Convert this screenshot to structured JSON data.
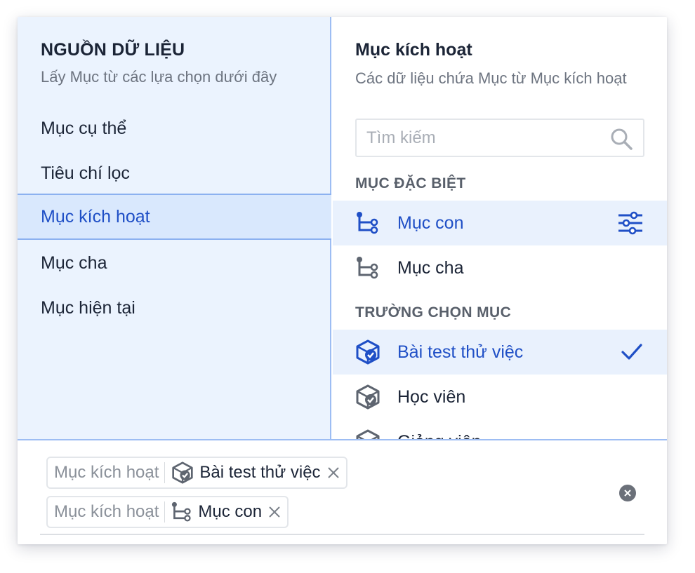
{
  "left": {
    "title": "NGUỒN DỮ LIỆU",
    "subtitle": "Lấy Mục từ các lựa chọn dưới đây",
    "items": [
      {
        "label": "Mục cụ thể"
      },
      {
        "label": "Tiêu chí lọc"
      },
      {
        "label": "Mục kích hoạt"
      },
      {
        "label": "Mục cha"
      },
      {
        "label": "Mục hiện tại"
      }
    ],
    "active_index": 2
  },
  "right": {
    "title": "Mục kích hoạt",
    "subtitle": "Các dữ liệu chứa Mục từ Mục kích hoạt",
    "search": {
      "placeholder": "Tìm kiếm"
    },
    "special_section": "MỤC ĐẶC BIỆT",
    "special_items": [
      {
        "label": "Mục con",
        "icon": "subitem-tree-icon",
        "selected": true,
        "trailing": "settings-sliders-icon"
      },
      {
        "label": "Mục cha",
        "icon": "parent-tree-icon",
        "selected": false
      }
    ],
    "field_section": "TRƯỜNG CHỌN MỤC",
    "field_items": [
      {
        "label": "Bài test thử việc",
        "icon": "cube-check-icon",
        "selected": true,
        "trailing": "checkmark-icon"
      },
      {
        "label": "Học viên",
        "icon": "cube-check-icon",
        "selected": false
      },
      {
        "label": "Giảng viên",
        "icon": "cube-check-icon",
        "selected": false
      }
    ]
  },
  "tags": [
    {
      "key": "Mục kích hoạt",
      "value": "Bài test thử việc",
      "icon": "cube-check-icon"
    },
    {
      "key": "Mục kích hoạt",
      "value": "Mục con",
      "icon": "subitem-tree-icon"
    }
  ],
  "colors": {
    "accent": "#1f4fc6",
    "left_bg": "#ebf3fe",
    "selected_bg": "#e9f1fd",
    "border_accent": "#9dbdf3"
  }
}
